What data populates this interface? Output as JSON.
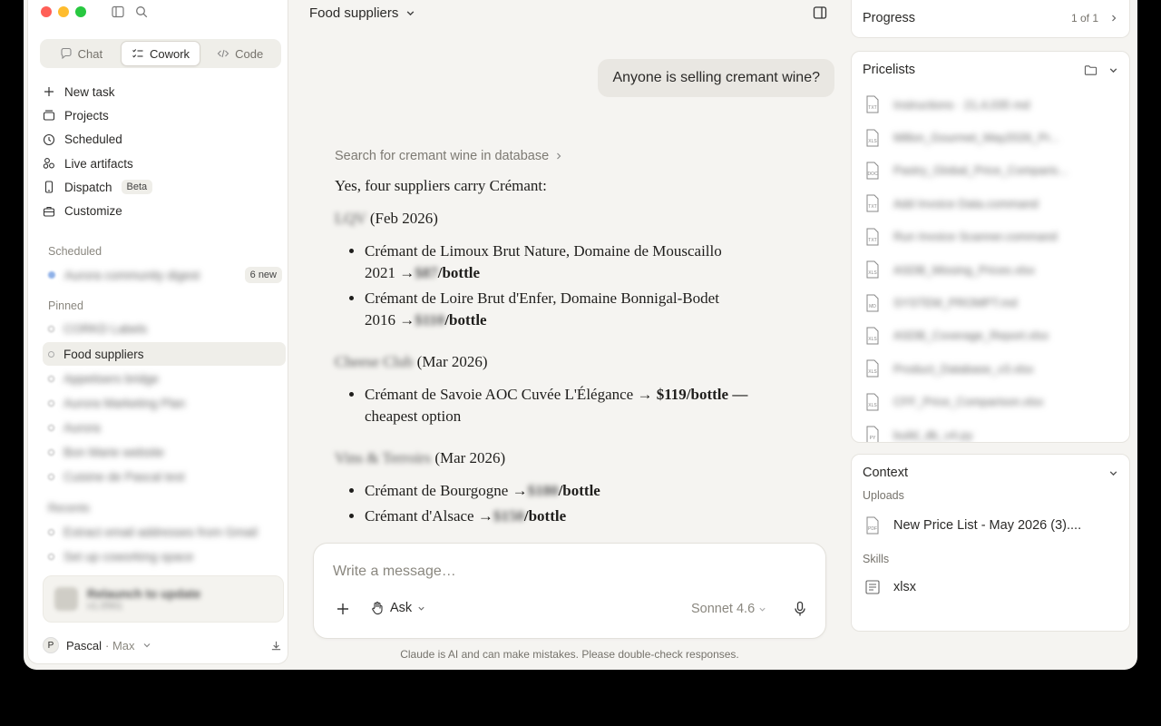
{
  "sidebar": {
    "tabs": [
      {
        "label": "Chat"
      },
      {
        "label": "Cowork"
      },
      {
        "label": "Code"
      }
    ],
    "nav": [
      {
        "label": "New task",
        "icon": "plus-icon"
      },
      {
        "label": "Projects",
        "icon": "projects-icon"
      },
      {
        "label": "Scheduled",
        "icon": "clock-icon"
      },
      {
        "label": "Live artifacts",
        "icon": "artifacts-icon"
      },
      {
        "label": "Dispatch",
        "icon": "phone-icon",
        "badge": "Beta"
      },
      {
        "label": "Customize",
        "icon": "briefcase-icon"
      }
    ],
    "scheduled_label": "Scheduled",
    "scheduled_item": {
      "label": "Aurora community digest",
      "badge": "6 new"
    },
    "pinned_label": "Pinned",
    "pinned": [
      {
        "label": "CORKD Labels"
      },
      {
        "label": "Food suppliers"
      },
      {
        "label": "Appetisers bridge"
      },
      {
        "label": "Aurora Marketing Plan"
      },
      {
        "label": "Aurora"
      },
      {
        "label": "Bon Marie website"
      },
      {
        "label": "Cuisine de Pascal test"
      }
    ],
    "recents_label": "Recents",
    "recents": [
      {
        "label": "Extract email addresses from Gmail"
      },
      {
        "label": "Set up coworking space"
      }
    ],
    "update": {
      "title": "Relaunch to update",
      "subtitle": "v1.0561"
    },
    "user": {
      "name": "Pascal",
      "plan": "· Max",
      "initial": "P"
    }
  },
  "main": {
    "title": "Food suppliers",
    "user_message": "Anyone is selling cremant wine?",
    "tool_line": "Search for cremant wine in database",
    "intro": "Yes, four suppliers carry Crémant:",
    "groups": [
      {
        "supplier": "LQV",
        "date": "(Feb 2026)",
        "items": [
          {
            "text_line1": "Crémant de Limoux Brut Nature, Domaine de Mouscaillo",
            "text_line2": "2021 →",
            "price": "$87",
            "unit": "/bottle",
            "suffix": ""
          },
          {
            "text_line1": "Crémant de Loire Brut d'Enfer, Domaine Bonnigal-Bodet",
            "text_line2": "2016 →",
            "price": "$110",
            "unit": "/bottle",
            "suffix": ""
          }
        ]
      },
      {
        "supplier": "Cheese Club",
        "date": "(Mar 2026)",
        "items": [
          {
            "text_line1": "Crémant de Savoie AOC Cuvée L'Élégance →",
            "text_line2": "",
            "price": "$119",
            "unit": "/bottle",
            "suffix": " —",
            "after": "cheapest option",
            "price_visible": true
          }
        ]
      },
      {
        "supplier": "Vins & Terroirs",
        "date": "(Mar 2026)",
        "items": [
          {
            "text_line1": "Crémant de Bourgogne →",
            "price": "$180",
            "unit": "/bottle"
          },
          {
            "text_line1": "Crémant d'Alsace →",
            "price": "$150",
            "unit": "/bottle"
          }
        ]
      }
    ],
    "composer": {
      "placeholder": "Write a message…",
      "mode": "Ask",
      "model": "Sonnet 4.6"
    },
    "disclaimer": "Claude is AI and can make mistakes. Please double-check responses."
  },
  "right": {
    "progress": {
      "title": "Progress",
      "count": "1 of 1"
    },
    "pricelists": {
      "title": "Pricelists",
      "files": [
        {
          "name": "Instructions · 21,4,035 md",
          "type": "TXT"
        },
        {
          "name": "Millon_Gourmet_May2026_Pr...",
          "type": "XLS"
        },
        {
          "name": "Pastry_Global_Price_Comparis...",
          "type": "DOC"
        },
        {
          "name": "Add Invoice Data.command",
          "type": "TXT"
        },
        {
          "name": "Run Invoice Scanner.command",
          "type": "TXT"
        },
        {
          "name": "ASDB_Missing_Prices.xlsx",
          "type": "XLS"
        },
        {
          "name": "SYSTEM_PROMPT.md",
          "type": "MD"
        },
        {
          "name": "ASDB_Coverage_Report.xlsx",
          "type": "XLS"
        },
        {
          "name": "Product_Database_v3.xlsx",
          "type": "XLS"
        },
        {
          "name": "CFF_Price_Comparison.xlsx",
          "type": "XLS"
        },
        {
          "name": "build_db_v4.py",
          "type": "PY"
        }
      ]
    },
    "context": {
      "title": "Context",
      "uploads_label": "Uploads",
      "upload_file": "New Price List - May 2026 (3)....",
      "upload_type": "PDF",
      "skills_label": "Skills",
      "skill": "xlsx"
    }
  }
}
